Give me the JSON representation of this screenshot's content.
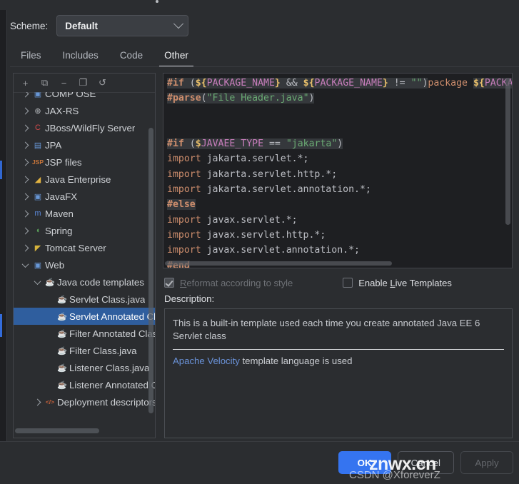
{
  "scheme": {
    "label": "Scheme:",
    "value": "Default",
    "chevron_icon": "chevron-down-icon"
  },
  "tabs": [
    {
      "label": "Files",
      "active": false
    },
    {
      "label": "Includes",
      "active": false
    },
    {
      "label": "Code",
      "active": false
    },
    {
      "label": "Other",
      "active": true
    }
  ],
  "tree_toolbar": [
    {
      "icon": "plus-icon",
      "glyph": "+"
    },
    {
      "icon": "add-file-icon",
      "glyph": "⧉"
    },
    {
      "icon": "minus-icon",
      "glyph": "−"
    },
    {
      "icon": "copy-icon",
      "glyph": "❐"
    },
    {
      "icon": "undo-reset-icon",
      "glyph": "↺"
    }
  ],
  "tree": [
    {
      "label": "COMP OSE",
      "indent": 0,
      "arrow": "closed",
      "icon": "module-icon",
      "glyph": "▣",
      "color": "#6897d6",
      "selected": false,
      "clipped": true
    },
    {
      "label": "JAX-RS",
      "indent": 0,
      "arrow": "closed",
      "icon": "globe-icon",
      "glyph": "⊕",
      "color": "#b9bcc0",
      "selected": false
    },
    {
      "label": "JBoss/WildFly Server",
      "indent": 0,
      "arrow": "closed",
      "icon": "jboss-icon",
      "glyph": "C",
      "color": "#d04a4a",
      "selected": false
    },
    {
      "label": "JPA",
      "indent": 0,
      "arrow": "closed",
      "icon": "jpa-icon",
      "glyph": "▤",
      "color": "#6897d6",
      "selected": false
    },
    {
      "label": "JSP files",
      "indent": 0,
      "arrow": "closed",
      "icon": "jsp-icon",
      "glyph": "JSP",
      "color": "#c9763a",
      "selected": false
    },
    {
      "label": "Java Enterprise",
      "indent": 0,
      "arrow": "closed",
      "icon": "java-enterprise-icon",
      "glyph": "◢",
      "color": "#e2b341",
      "selected": false
    },
    {
      "label": "JavaFX",
      "indent": 0,
      "arrow": "closed",
      "icon": "javafx-icon",
      "glyph": "▣",
      "color": "#6897d6",
      "selected": false
    },
    {
      "label": "Maven",
      "indent": 0,
      "arrow": "closed",
      "icon": "maven-icon",
      "glyph": "m",
      "color": "#5b87d8",
      "selected": false
    },
    {
      "label": "Spring",
      "indent": 0,
      "arrow": "closed",
      "icon": "spring-icon",
      "glyph": "◖",
      "color": "#5aa05a",
      "selected": false
    },
    {
      "label": "Tomcat Server",
      "indent": 0,
      "arrow": "closed",
      "icon": "tomcat-icon",
      "glyph": "◤",
      "color": "#d6b33c",
      "selected": false
    },
    {
      "label": "Web",
      "indent": 0,
      "arrow": "open",
      "icon": "web-icon",
      "glyph": "▣",
      "color": "#6897d6",
      "selected": false
    },
    {
      "label": "Java code templates",
      "indent": 1,
      "arrow": "open",
      "icon": "java-template-icon",
      "glyph": "☕",
      "color": "#c4603a",
      "selected": false
    },
    {
      "label": "Servlet Class.java",
      "indent": 2,
      "arrow": "none",
      "icon": "java-file-icon",
      "glyph": "☕",
      "color": "#c4603a",
      "selected": false
    },
    {
      "label": "Servlet Annotated Class.java",
      "indent": 2,
      "arrow": "none",
      "icon": "java-file-icon",
      "glyph": "☕",
      "color": "#c4603a",
      "selected": true
    },
    {
      "label": "Filter Annotated Class.java",
      "indent": 2,
      "arrow": "none",
      "icon": "java-file-icon",
      "glyph": "☕",
      "color": "#c4603a",
      "selected": false
    },
    {
      "label": "Filter Class.java",
      "indent": 2,
      "arrow": "none",
      "icon": "java-file-icon",
      "glyph": "☕",
      "color": "#c4603a",
      "selected": false
    },
    {
      "label": "Listener Class.java",
      "indent": 2,
      "arrow": "none",
      "icon": "java-file-icon",
      "glyph": "☕",
      "color": "#c4603a",
      "selected": false
    },
    {
      "label": "Listener Annotated Class.java",
      "indent": 2,
      "arrow": "none",
      "icon": "java-file-icon",
      "glyph": "☕",
      "color": "#c4603a",
      "selected": false
    },
    {
      "label": "Deployment descriptors",
      "indent": 1,
      "arrow": "closed",
      "icon": "xml-code-icon",
      "glyph": "</>",
      "color": "#c4603a",
      "selected": false
    }
  ],
  "editor": {
    "lines": [
      [
        {
          "t": "#if",
          "c": "kw"
        },
        {
          "t": " ",
          "c": "hl"
        },
        {
          "t": "(",
          "c": "paren hl"
        },
        {
          "t": "${",
          "c": "dollar hl"
        },
        {
          "t": "PACKAGE_NAME",
          "c": "var hl"
        },
        {
          "t": "}",
          "c": "dollar hl"
        },
        {
          "t": " ",
          "c": "hl"
        },
        {
          "t": "&&",
          "c": "op hl"
        },
        {
          "t": " ",
          "c": "hl"
        },
        {
          "t": "${",
          "c": "dollar hl"
        },
        {
          "t": "PACKAGE_NAME",
          "c": "var hl"
        },
        {
          "t": "}",
          "c": "dollar hl"
        },
        {
          "t": " ",
          "c": "hl"
        },
        {
          "t": "!=",
          "c": "op hl"
        },
        {
          "t": " ",
          "c": "hl"
        },
        {
          "t": "\"\"",
          "c": "str hl"
        },
        {
          "t": ")",
          "c": "paren hl"
        },
        {
          "t": "package ",
          "c": "kw2"
        },
        {
          "t": "${",
          "c": "dollar hl"
        },
        {
          "t": "PACKA",
          "c": "var hl"
        }
      ],
      [
        {
          "t": "#parse",
          "c": "kw"
        },
        {
          "t": "(",
          "c": "paren hl"
        },
        {
          "t": "\"File Header.java\"",
          "c": "str hl"
        },
        {
          "t": ")",
          "c": "paren hl"
        }
      ],
      [],
      [],
      [
        {
          "t": "#if",
          "c": "kw"
        },
        {
          "t": " ",
          "c": "hl"
        },
        {
          "t": "(",
          "c": "paren hl"
        },
        {
          "t": "$",
          "c": "dollar hl"
        },
        {
          "t": "JAVAEE_TYPE",
          "c": "var hl"
        },
        {
          "t": " ",
          "c": "hl"
        },
        {
          "t": "==",
          "c": "op hl"
        },
        {
          "t": " ",
          "c": "hl"
        },
        {
          "t": "\"jakarta\"",
          "c": "str hl"
        },
        {
          "t": ")",
          "c": "paren hl"
        }
      ],
      [
        {
          "t": "import",
          "c": "kw2"
        },
        {
          "t": " jakarta.servlet.*;",
          "c": "plain"
        }
      ],
      [
        {
          "t": "import",
          "c": "kw2"
        },
        {
          "t": " jakarta.servlet.http.*;",
          "c": "plain"
        }
      ],
      [
        {
          "t": "import",
          "c": "kw2"
        },
        {
          "t": " jakarta.servlet.annotation.*;",
          "c": "plain"
        }
      ],
      [
        {
          "t": "#else",
          "c": "kw"
        }
      ],
      [
        {
          "t": "import",
          "c": "kw2"
        },
        {
          "t": " javax.servlet.*;",
          "c": "plain"
        }
      ],
      [
        {
          "t": "import",
          "c": "kw2"
        },
        {
          "t": " javax.servlet.http.*;",
          "c": "plain"
        }
      ],
      [
        {
          "t": "import",
          "c": "kw2"
        },
        {
          "t": " javax.servlet.annotation.*;",
          "c": "plain"
        }
      ],
      [
        {
          "t": "#end",
          "c": "kw"
        }
      ]
    ]
  },
  "options": {
    "reformat": {
      "label_pre": "",
      "label_u": "R",
      "label_post": "eformat according to style",
      "checked": true,
      "enabled": false
    },
    "live_templates": {
      "label_pre": "Enable ",
      "label_u": "L",
      "label_post": "ive Templates",
      "checked": false,
      "enabled": true
    }
  },
  "description": {
    "label": "Description:",
    "text": "This is a built-in template used each time you create annotated Java EE 6 Servlet class",
    "footer_link": "Apache Velocity",
    "footer_rest": " template language is used"
  },
  "buttons": {
    "ok": "OK",
    "cancel": "Cancel",
    "apply": "Apply"
  },
  "watermark": {
    "line1": "znwx.cn",
    "line2": "CSDN @XforeverZ"
  }
}
